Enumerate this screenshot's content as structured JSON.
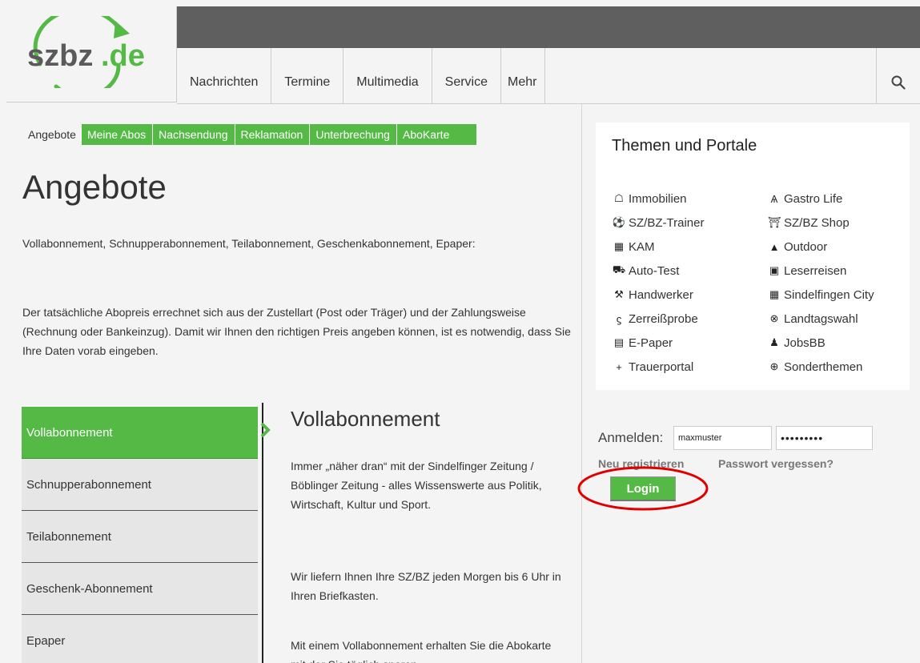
{
  "logo": {
    "text": "szbz",
    "suffix": ".de",
    "color": "#55b946"
  },
  "nav": {
    "items": [
      "Nachrichten",
      "Termine",
      "Multimedia",
      "Service",
      "Mehr"
    ],
    "search_icon": "search-icon"
  },
  "subnav": {
    "current": "Angebote",
    "items": [
      "Meine Abos",
      "Nachsendung",
      "Reklamation",
      "Unterbrechung",
      "AboKarte"
    ]
  },
  "page": {
    "title": "Angebote",
    "intro1": "Vollabonnement, Schnupperabonnement, Teilabonnement, Geschenkabonnement, Epaper:",
    "intro2": "Der tatsächliche Abopreis errechnet sich aus der Zustellart (Post oder Träger) und der Zahlungsweise (Rechnung oder Bankeinzug). Damit wir Ihnen den richtigen Preis angeben können, ist es notwendig, dass Sie Ihre Daten vorab eingeben."
  },
  "abo_menu": [
    "Vollabonnement",
    "Schnupperabonnement",
    "Teilabonnement",
    "Geschenk-Abonnement",
    "Epaper"
  ],
  "detail": {
    "title": "Vollabonnement",
    "p1": "Immer „näher dran“ mit der Sindelfinger Zeitung / Böblinger Zeitung - alles Wissenswerte aus Politik, Wirtschaft, Kultur und Sport.",
    "p2": "Wir liefern Ihnen Ihre SZ/BZ jeden Morgen bis 6 Uhr in Ihren Briefkasten.",
    "p3": "Mit einem Vollabonnement erhalten Sie die Abokarte mit der Sie täglich sparen"
  },
  "portals": {
    "title": "Themen und Portale",
    "col1": [
      {
        "label": "Immobilien",
        "icon": "house-icon",
        "glyph": "🏠"
      },
      {
        "label": "SZ/BZ-Trainer",
        "icon": "soccer-ball-icon",
        "glyph": "⚽"
      },
      {
        "label": "KAM",
        "icon": "grid-icon",
        "glyph": "▦"
      },
      {
        "label": "Auto-Test",
        "icon": "car-icon",
        "glyph": "🚗"
      },
      {
        "label": "Handwerker",
        "icon": "hammer-icon",
        "glyph": "⚒"
      },
      {
        "label": "Zerreißprobe",
        "icon": "lightning-icon",
        "glyph": "ϟ"
      },
      {
        "label": "E-Paper",
        "icon": "newspaper-icon",
        "glyph": "▤"
      },
      {
        "label": "Trauerportal",
        "icon": "cross-icon",
        "glyph": "✝"
      }
    ],
    "col2": [
      {
        "label": "Gastro Life",
        "icon": "cutlery-icon",
        "glyph": "🍴"
      },
      {
        "label": "SZ/BZ Shop",
        "icon": "cart-icon",
        "glyph": "🛒"
      },
      {
        "label": "Outdoor",
        "icon": "tent-icon",
        "glyph": "⛺"
      },
      {
        "label": "Leserreisen",
        "icon": "suitcase-icon",
        "glyph": "🧳"
      },
      {
        "label": "Sindelfingen City",
        "icon": "map-icon",
        "glyph": "🗺"
      },
      {
        "label": "Landtagswahl",
        "icon": "close-circle-icon",
        "glyph": "⊗"
      },
      {
        "label": "JobsBB",
        "icon": "user-icon",
        "glyph": "👤"
      },
      {
        "label": "Sonderthemen",
        "icon": "plus-circle-icon",
        "glyph": "⊕"
      }
    ]
  },
  "login": {
    "label": "Anmelden:",
    "username": "maxmuster",
    "password": "•••••••••",
    "register": "Neu registrieren",
    "forgot": "Passwort vergessen?",
    "button": "Login",
    "highlight_color": "#e00000"
  }
}
